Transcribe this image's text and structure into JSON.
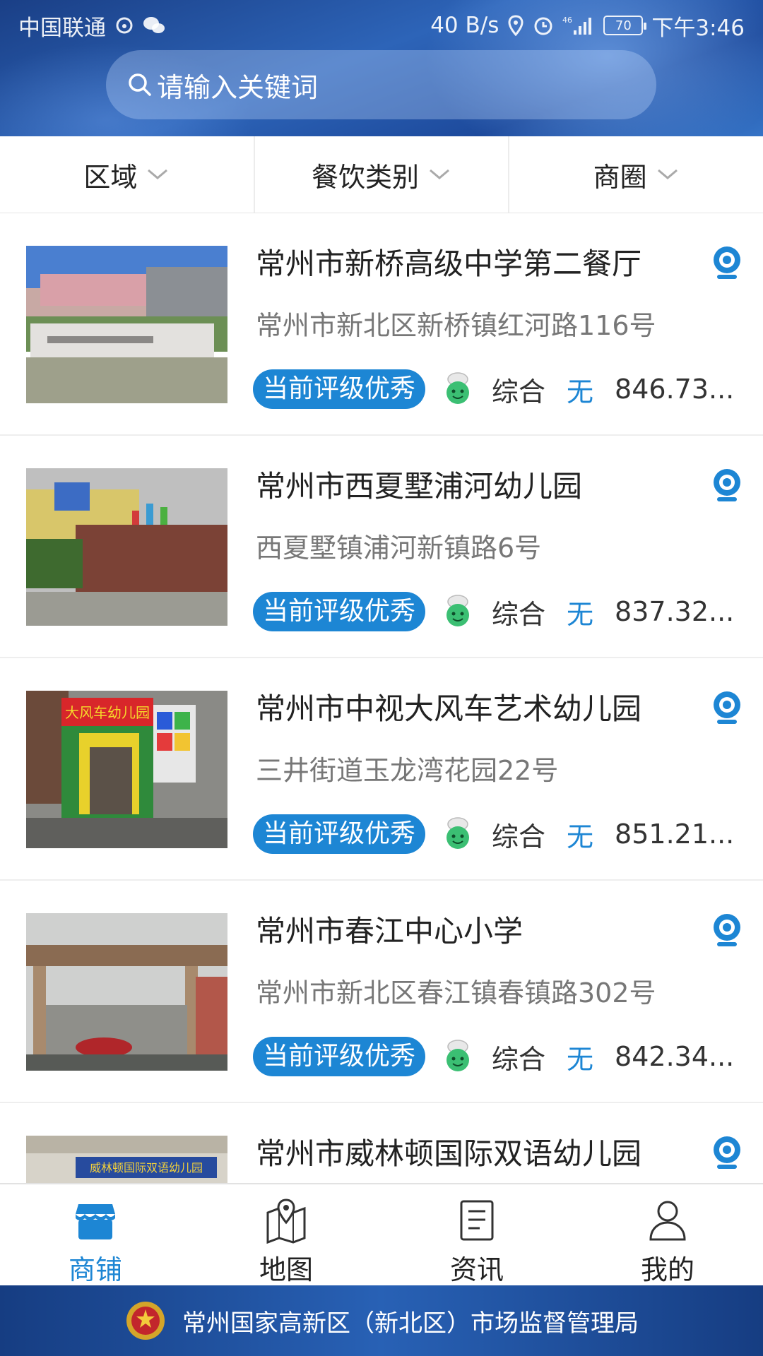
{
  "status_bar": {
    "carrier": "中国联通",
    "speed": "40 B/s",
    "battery": "70",
    "time": "下午3:46",
    "network": "46"
  },
  "search": {
    "placeholder": "请输入关键词"
  },
  "filters": [
    {
      "label": "区域"
    },
    {
      "label": "餐饮类别"
    },
    {
      "label": "商圈"
    }
  ],
  "shops": [
    {
      "name": "常州市新桥高级中学第二餐厅",
      "address": "常州市新北区新桥镇红河路116号",
      "rating": "当前评级优秀",
      "category": "综合",
      "status": "无",
      "distance": "846.73..."
    },
    {
      "name": "常州市西夏墅浦河幼儿园",
      "address": "西夏墅镇浦河新镇路6号",
      "rating": "当前评级优秀",
      "category": "综合",
      "status": "无",
      "distance": "837.32..."
    },
    {
      "name": "常州市中视大风车艺术幼儿园",
      "address": "三井街道玉龙湾花园22号",
      "rating": "当前评级优秀",
      "category": "综合",
      "status": "无",
      "distance": "851.21..."
    },
    {
      "name": "常州市春江中心小学",
      "address": "常州市新北区春江镇春镇路302号",
      "rating": "当前评级优秀",
      "category": "综合",
      "status": "无",
      "distance": "842.34..."
    },
    {
      "name": "常州市威林顿国际双语幼儿园",
      "address": "",
      "rating": "",
      "category": "",
      "status": "",
      "distance": ""
    }
  ],
  "thumb_texts": {
    "sign_3": "大风车幼儿园",
    "sign_5": "威林顿国际双语幼儿园"
  },
  "nav": [
    {
      "label": "商铺",
      "icon": "shop-icon",
      "active": true
    },
    {
      "label": "地图",
      "icon": "map-icon",
      "active": false
    },
    {
      "label": "资讯",
      "icon": "news-icon",
      "active": false
    },
    {
      "label": "我的",
      "icon": "user-icon",
      "active": false
    }
  ],
  "footer": {
    "text": "常州国家高新区（新北区）市场监督管理局"
  },
  "colors": {
    "accent": "#1d86d4",
    "header": "#2d64b8",
    "footer": "#1f4f9c"
  }
}
